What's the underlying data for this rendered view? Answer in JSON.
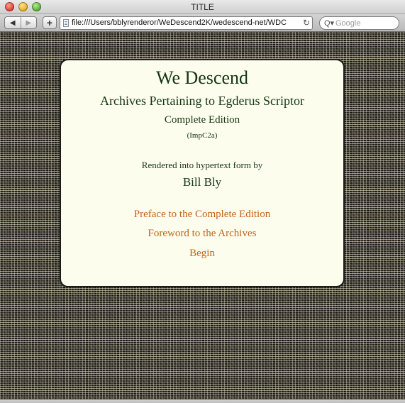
{
  "window": {
    "title": "TITLE"
  },
  "toolbar": {
    "back_label": "◀",
    "forward_label": "▶",
    "add_label": "+",
    "url": "file:///Users/bblyrenderor/WeDescend2K/wedescend-net/WDC",
    "reload_label": "↻",
    "search_placeholder": "Google",
    "search_icon_label": "Q▾"
  },
  "page": {
    "title": "We Descend",
    "subtitle": "Archives Pertaining to Egderus Scriptor",
    "edition": "Complete Edition",
    "code": "(ImpC2a)",
    "rendered_by": "Rendered into hypertext form by",
    "author": "Bill Bly",
    "links": [
      {
        "label": "Preface to the Complete Edition"
      },
      {
        "label": "Foreword to the Archives"
      },
      {
        "label": "Begin"
      }
    ]
  },
  "colors": {
    "panel_background": "#fdfded",
    "heading_text": "#143614",
    "link_text": "#c2631b"
  }
}
